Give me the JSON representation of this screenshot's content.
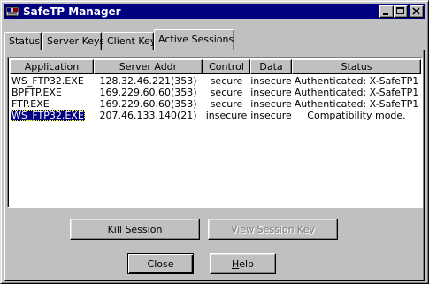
{
  "window": {
    "title": "SafeTP Manager"
  },
  "tabs": [
    {
      "label": "Status"
    },
    {
      "label": "Server Keys"
    },
    {
      "label": "Client Key"
    },
    {
      "label": "Active Sessions"
    }
  ],
  "table": {
    "columns": [
      "Application",
      "Server Addr",
      "Control",
      "Data",
      "Status"
    ],
    "rows": [
      [
        "WS_FTP32.EXE",
        "128.32.46.221(353)",
        "secure",
        "insecure",
        "Authenticated: X-SafeTP1"
      ],
      [
        "BPFTP.EXE",
        "169.229.60.60(353)",
        "secure",
        "insecure",
        "Authenticated: X-SafeTP1"
      ],
      [
        "FTP.EXE",
        "169.229.60.60(353)",
        "secure",
        "insecure",
        "Authenticated: X-SafeTP1"
      ],
      [
        "WS_FTP32.EXE",
        "207.46.133.140(21)",
        "insecure",
        "insecure",
        "Compatibility mode."
      ]
    ],
    "selected_row": 4
  },
  "buttons": {
    "kill_session": "Kill Session",
    "view_session_key": "View Session Key",
    "close": "Close",
    "help_first": "H",
    "help_rest": "elp"
  }
}
